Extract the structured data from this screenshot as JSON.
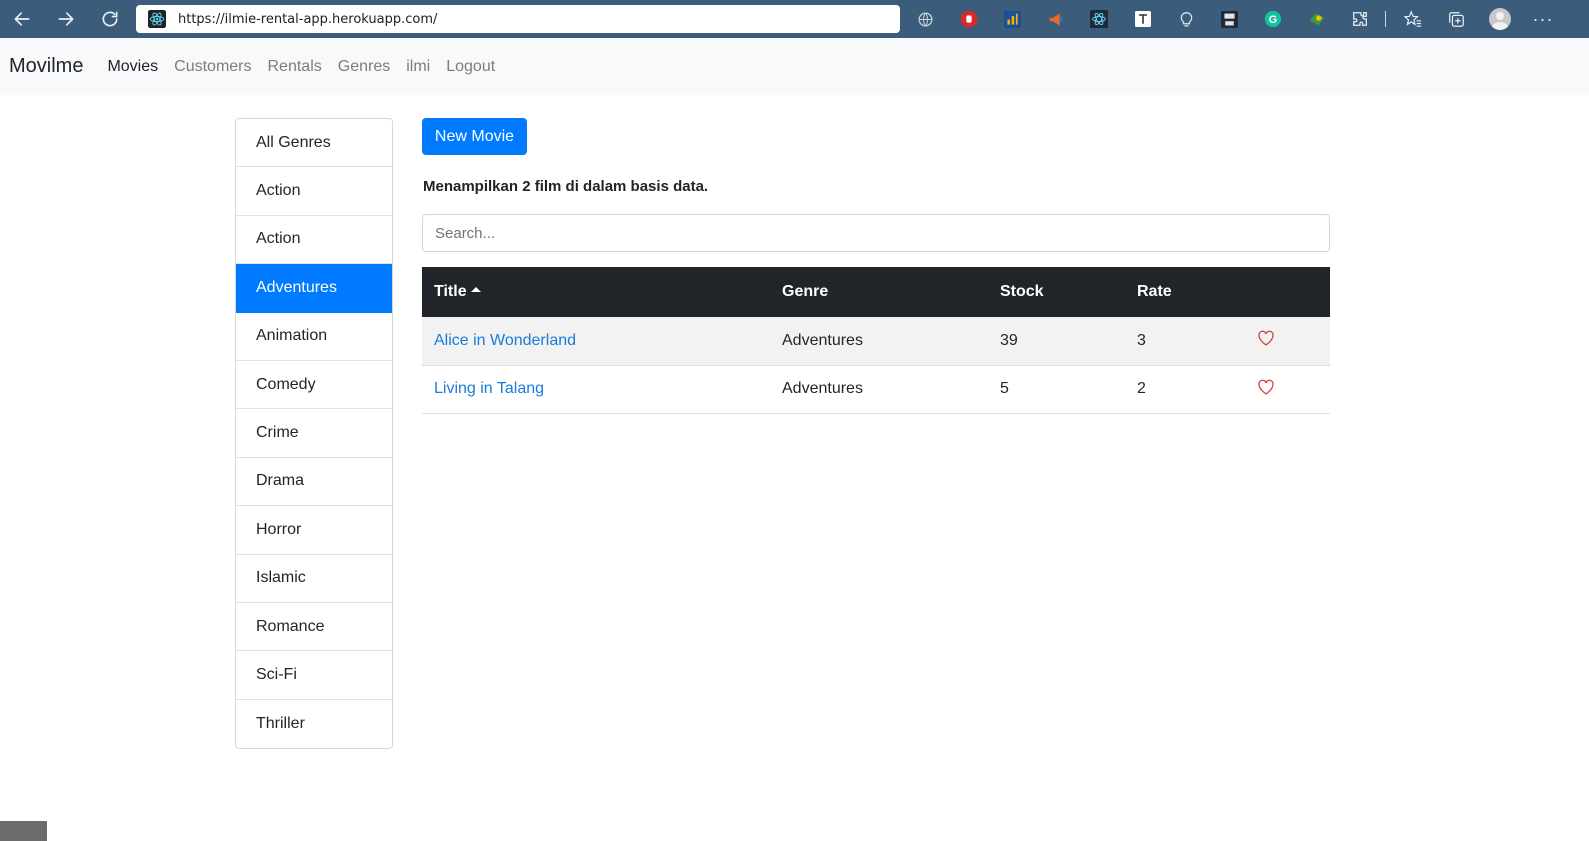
{
  "browser": {
    "url": "https://ilmie-rental-app.herokuapp.com/",
    "extensions": [
      {
        "name": "globe-icon",
        "color": "#9aa7b3"
      },
      {
        "name": "adblock-icon",
        "color": "#d9292b"
      },
      {
        "name": "analytics-icon",
        "color": "#1c4f9a"
      },
      {
        "name": "megaphone-icon",
        "color": "#e86b2b"
      },
      {
        "name": "react-devtools-icon",
        "color": "#1f2a36"
      },
      {
        "name": "text-tool-icon",
        "color": "#ffffff"
      },
      {
        "name": "lightbulb-icon",
        "color": "#dfe6ec"
      },
      {
        "name": "save-icon",
        "color": "#1f2a36"
      },
      {
        "name": "grammarly-icon",
        "color": "#15c39a"
      },
      {
        "name": "earth-icon",
        "color": "#3c9a3c"
      }
    ]
  },
  "navbar": {
    "brand": "Movilme",
    "links": [
      {
        "label": "Movies",
        "active": true
      },
      {
        "label": "Customers",
        "active": false
      },
      {
        "label": "Rentals",
        "active": false
      },
      {
        "label": "Genres",
        "active": false
      },
      {
        "label": "ilmi",
        "active": false
      },
      {
        "label": "Logout",
        "active": false
      }
    ]
  },
  "sidebar": {
    "genres": [
      "All Genres",
      "Action",
      "Action",
      "Adventures",
      "Animation",
      "Comedy",
      "Crime",
      "Drama",
      "Horror",
      "Islamic",
      "Romance",
      "Sci-Fi",
      "Thriller"
    ],
    "selected": "Adventures"
  },
  "main": {
    "new_movie_label": "New Movie",
    "summary": "Menampilkan 2 film di dalam basis data.",
    "search_placeholder": "Search...",
    "table": {
      "headers": [
        "Title",
        "Genre",
        "Stock",
        "Rate"
      ],
      "sort_column": "Title",
      "rows": [
        {
          "title": "Alice in Wonderland",
          "genre": "Adventures",
          "stock": "39",
          "rate": "3"
        },
        {
          "title": "Living in Talang",
          "genre": "Adventures",
          "stock": "5",
          "rate": "2"
        }
      ]
    }
  },
  "colors": {
    "primary": "#007bff",
    "table_header": "#212529",
    "link": "#1a7bd8",
    "heart": "#e03c3c",
    "browser_chrome": "#3b5c7a"
  }
}
